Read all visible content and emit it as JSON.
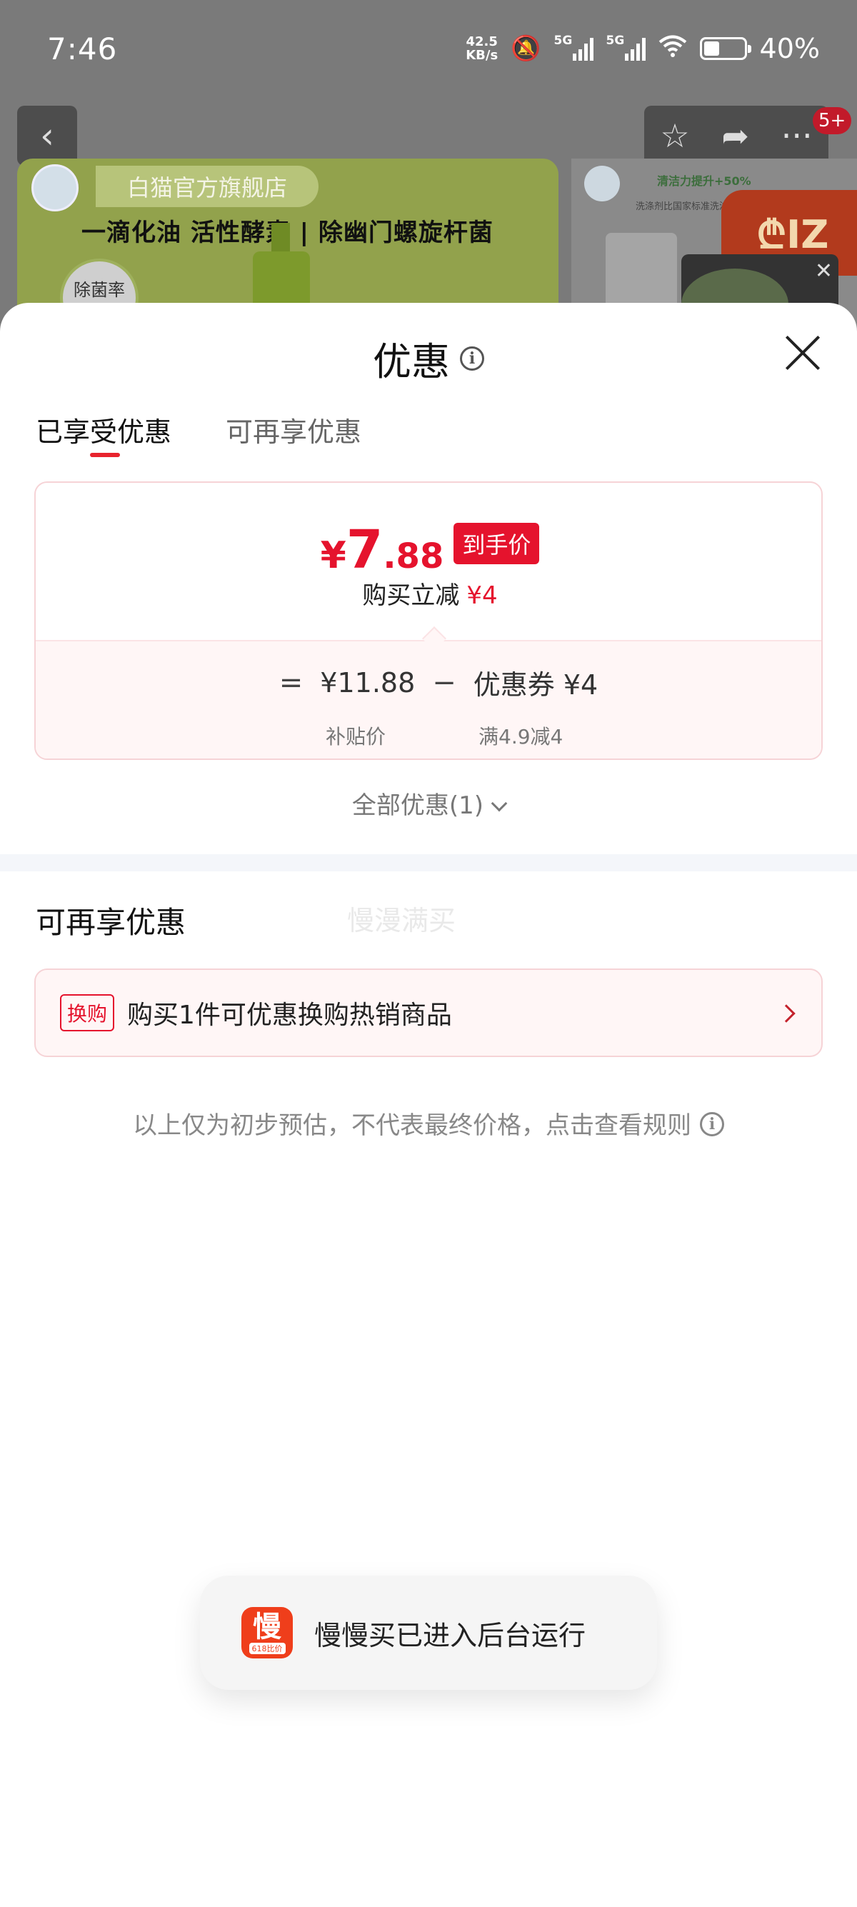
{
  "status_bar": {
    "time": "7:46",
    "net_speed_value": "42.5",
    "net_speed_unit": "KB/s",
    "signal_label_1": "5G",
    "signal_label_2": "5G",
    "battery_percent": "40%",
    "battery_level": 0.4
  },
  "header_actions": {
    "back_icon": "chevron-left-icon",
    "star_icon": "star-icon",
    "share_icon": "share-icon",
    "more_icon": "more-icon",
    "badge": "5+"
  },
  "banner": {
    "store_name": "白猫官方旗舰店",
    "slogan": "一滴化油 活性酵素 | 除幽门螺旋杆菌",
    "chip": "除菌率",
    "side_line": "清洁力提升+50%",
    "side_line2": "洗涤剂比国家标准洗涤剂",
    "promo": "₾IZ"
  },
  "sheet": {
    "title": "优惠",
    "tabs": [
      {
        "label": "已享受优惠",
        "active": true
      },
      {
        "label": "可再享优惠",
        "active": false
      }
    ],
    "final_price": {
      "currency": "¥",
      "integer": "7",
      "decimal": ".88",
      "tag": "到手价"
    },
    "reduce_label": "购买立减",
    "reduce_amount": "¥4",
    "calc": {
      "equals": "=",
      "base_price": "¥11.88",
      "base_label": "补贴价",
      "minus": "−",
      "coupon": "优惠券 ¥4",
      "coupon_label": "满4.9减4"
    },
    "all_offers": "全部优惠(1)",
    "section_title": "可再享优惠",
    "watermark": "慢漫满买",
    "exchange": {
      "tag": "换购",
      "text": "购买1件可优惠换购热销商品"
    },
    "disclaimer": "以上仅为初步预估，不代表最终价格，点击查看规则"
  },
  "toast": {
    "icon_text": "慢",
    "icon_sub": "618比价",
    "text": "慢慢买已进入后台运行"
  },
  "colors": {
    "accent_red": "#e5132d",
    "dim_bg": "#6e6e6e"
  }
}
